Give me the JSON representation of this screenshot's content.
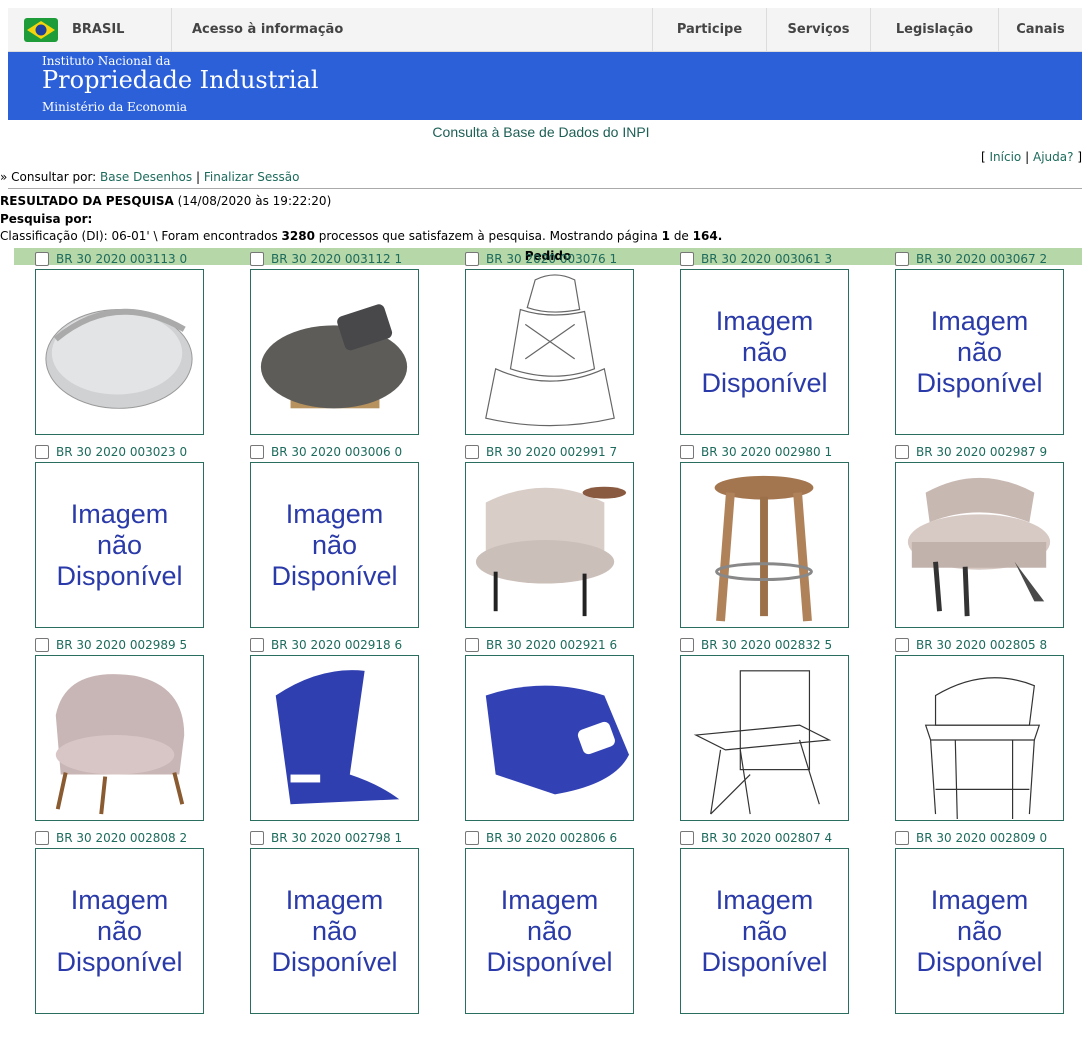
{
  "govbar": {
    "brasil": "BRASIL",
    "acesso": "Acesso à informação",
    "links": [
      "Participe",
      "Serviços",
      "Legislação",
      "Canais"
    ]
  },
  "header": {
    "line1": "Instituto Nacional da",
    "line2": "Propriedade Industrial",
    "line3": "Ministério da Economia"
  },
  "consulta_title": "Consulta à Base de Dados do INPI",
  "toplinks": {
    "open": "[",
    "inicio": "Início",
    "sep": "|",
    "ajuda": "Ajuda?",
    "close": "]"
  },
  "consultar": {
    "prefix": "» Consultar por:",
    "base": "Base Desenhos",
    "sep": "|",
    "finalizar": "Finalizar Sessão"
  },
  "resultado": {
    "title": "RESULTADO DA PESQUISA",
    "date": "(14/08/2020 às 19:22:20)"
  },
  "pesquisa_por": "Pesquisa por:",
  "classificacao": {
    "prefix": "Classificação (DI): 06-01' \\ Foram encontrados",
    "count": "3280",
    "middle": "processos que satisfazem à pesquisa. Mostrando página",
    "page": "1",
    "de": "de",
    "total": "164."
  },
  "pedido_header": "Pedido",
  "na_text": [
    "Imagem",
    "não",
    "Disponível"
  ],
  "items": [
    {
      "code": "BR 30 2020 003113 0",
      "image": "round-tray"
    },
    {
      "code": "BR 30 2020 003112 1",
      "image": "round-table"
    },
    {
      "code": "BR 30 2020 003076 1",
      "image": "car-seat-sketch"
    },
    {
      "code": "BR 30 2020 003061 3",
      "image": "none"
    },
    {
      "code": "BR 30 2020 003067 2",
      "image": "none"
    },
    {
      "code": "BR 30 2020 003023 0",
      "image": "none"
    },
    {
      "code": "BR 30 2020 003006 0",
      "image": "none"
    },
    {
      "code": "BR 30 2020 002991 7",
      "image": "armchair-with-side-table"
    },
    {
      "code": "BR 30 2020 002980 1",
      "image": "wooden-stool"
    },
    {
      "code": "BR 30 2020 002987 9",
      "image": "round-armchair"
    },
    {
      "code": "BR 30 2020 002989 5",
      "image": "pink-armchair"
    },
    {
      "code": "BR 30 2020 002918 6",
      "image": "blue-shell-seat"
    },
    {
      "code": "BR 30 2020 002921 6",
      "image": "blue-shell-chair"
    },
    {
      "code": "BR 30 2020 002832 5",
      "image": "chair-sketch"
    },
    {
      "code": "BR 30 2020 002805 8",
      "image": "stool-sketch"
    },
    {
      "code": "BR 30 2020 002808 2",
      "image": "none"
    },
    {
      "code": "BR 30 2020 002798 1",
      "image": "none"
    },
    {
      "code": "BR 30 2020 002806 6",
      "image": "none"
    },
    {
      "code": "BR 30 2020 002807 4",
      "image": "none"
    },
    {
      "code": "BR 30 2020 002809 0",
      "image": "none"
    }
  ]
}
